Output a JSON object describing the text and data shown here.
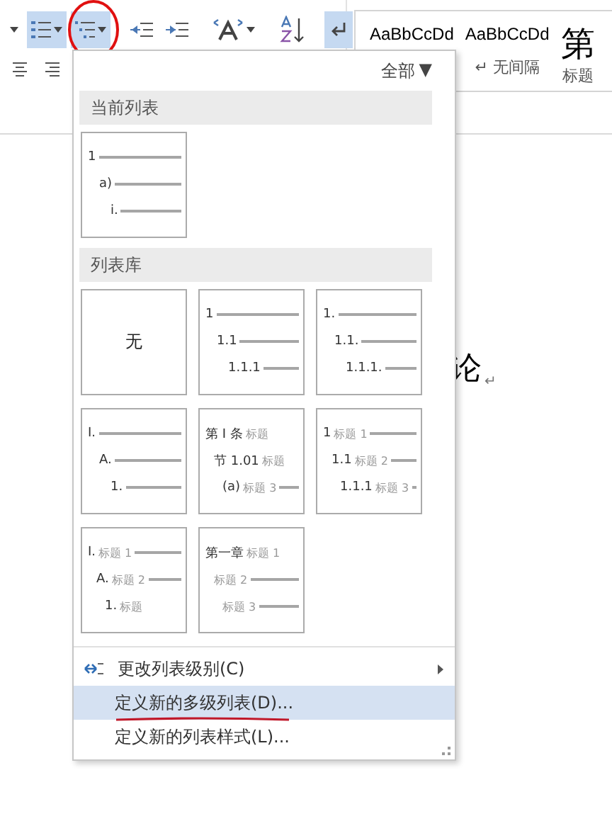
{
  "toolbar": {
    "buttons": [
      {
        "kind": "bullets-caret",
        "selected": false,
        "annotated": false
      },
      {
        "kind": "numbering",
        "selected": true,
        "annotated": false
      },
      {
        "kind": "multilevel",
        "selected": true,
        "annotated": true
      },
      {
        "kind": "outdent",
        "selected": false,
        "annotated": false
      },
      {
        "kind": "indent",
        "selected": false,
        "annotated": false
      },
      {
        "kind": "text-direction",
        "selected": false,
        "annotated": false
      },
      {
        "kind": "sort",
        "selected": false,
        "annotated": false
      },
      {
        "kind": "marks",
        "selected": true,
        "annotated": false
      }
    ],
    "row2": [
      {
        "kind": "align-center"
      },
      {
        "kind": "align-right"
      }
    ]
  },
  "styles": [
    {
      "kind": "normal",
      "preview": "AaBbCcDd"
    },
    {
      "kind": "normal",
      "preview": "AaBbCcDd",
      "name": "无间隔",
      "mark": "↵"
    },
    {
      "kind": "large",
      "preview": "第",
      "name": "标题"
    }
  ],
  "document": {
    "text": "论",
    "mark": "↵"
  },
  "menu": {
    "filter": "全部",
    "filter_caret": "▼",
    "sections": [
      {
        "title": "当前列表",
        "tiles": [
          {
            "kind": "levels",
            "levels": [
              {
                "number": "1",
                "line": true
              },
              {
                "number": "a)",
                "line": true
              },
              {
                "number": "i.",
                "line": true
              }
            ]
          }
        ]
      },
      {
        "title": "列表库",
        "tiles": [
          {
            "kind": "none",
            "text": "无"
          },
          {
            "kind": "levels",
            "levels": [
              {
                "number": "1",
                "line": true
              },
              {
                "number": "1.1",
                "line": true
              },
              {
                "number": "1.1.1",
                "line": true
              }
            ]
          },
          {
            "kind": "levels",
            "levels": [
              {
                "number": "1.",
                "line": true
              },
              {
                "number": "1.1.",
                "line": true
              },
              {
                "number": "1.1.1.",
                "line": true
              }
            ]
          },
          {
            "kind": "levels",
            "levels": [
              {
                "number": "I.",
                "line": true
              },
              {
                "number": "A.",
                "line": true
              },
              {
                "number": "1.",
                "line": true
              }
            ]
          },
          {
            "kind": "levels",
            "levels": [
              {
                "number": "第 I 条",
                "heading": "标题",
                "line": false
              },
              {
                "number": "节 1.01",
                "heading": "标题",
                "line": false
              },
              {
                "number": "(a)",
                "heading": "标题 3",
                "line": true
              }
            ]
          },
          {
            "kind": "levels",
            "levels": [
              {
                "number": "1",
                "heading": "标题 1",
                "line": true
              },
              {
                "number": "1.1",
                "heading": "标题 2",
                "line": true
              },
              {
                "number": "1.1.1",
                "heading": "标题 3",
                "line": true
              }
            ]
          },
          {
            "kind": "levels",
            "levels": [
              {
                "number": "I.",
                "heading": "标题 1",
                "line": true
              },
              {
                "number": "A.",
                "heading": "标题 2",
                "line": true
              },
              {
                "number": "1.",
                "heading": "标题",
                "line": false
              }
            ]
          },
          {
            "kind": "levels",
            "levels": [
              {
                "number": "第一章",
                "heading": "标题 1",
                "line": false
              },
              {
                "heading": "标题 2",
                "line": true
              },
              {
                "heading": "标题 3",
                "line": true
              }
            ]
          }
        ]
      }
    ],
    "items": [
      {
        "kind": "submenu",
        "label": "更改列表级别(C)",
        "selected": false,
        "annotated": false
      },
      {
        "kind": "plain",
        "label": "定义新的多级列表(D)...",
        "selected": true,
        "annotated": true
      },
      {
        "kind": "plain",
        "label": "定义新的列表样式(L)...",
        "selected": false,
        "annotated": false
      }
    ]
  }
}
